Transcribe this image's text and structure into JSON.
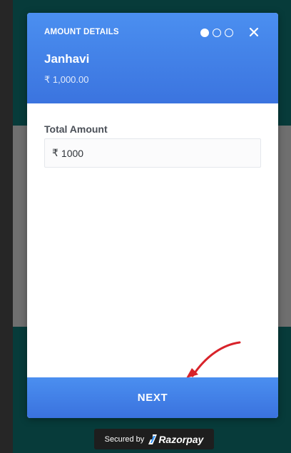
{
  "modal": {
    "step_title": "AMOUNT DETAILS",
    "progress": {
      "current_step": 1,
      "total_steps": 3
    },
    "merchant_name": "Janhavi",
    "header_amount": "₹ 1,000.00"
  },
  "form": {
    "amount_label": "Total Amount",
    "currency_symbol": "₹",
    "amount_value": "1000"
  },
  "actions": {
    "next_label": "NEXT"
  },
  "footer": {
    "secured_by": "Secured by",
    "brand_name": "Razorpay"
  },
  "colors": {
    "accent_blue": "#3b7ddf",
    "annotation_red": "#d8232a",
    "page_dark_teal": "#073b3a"
  },
  "icons": {
    "close": "close-icon",
    "arrow": "annotation-arrow-icon",
    "brand": "razorpay-logo-icon"
  }
}
